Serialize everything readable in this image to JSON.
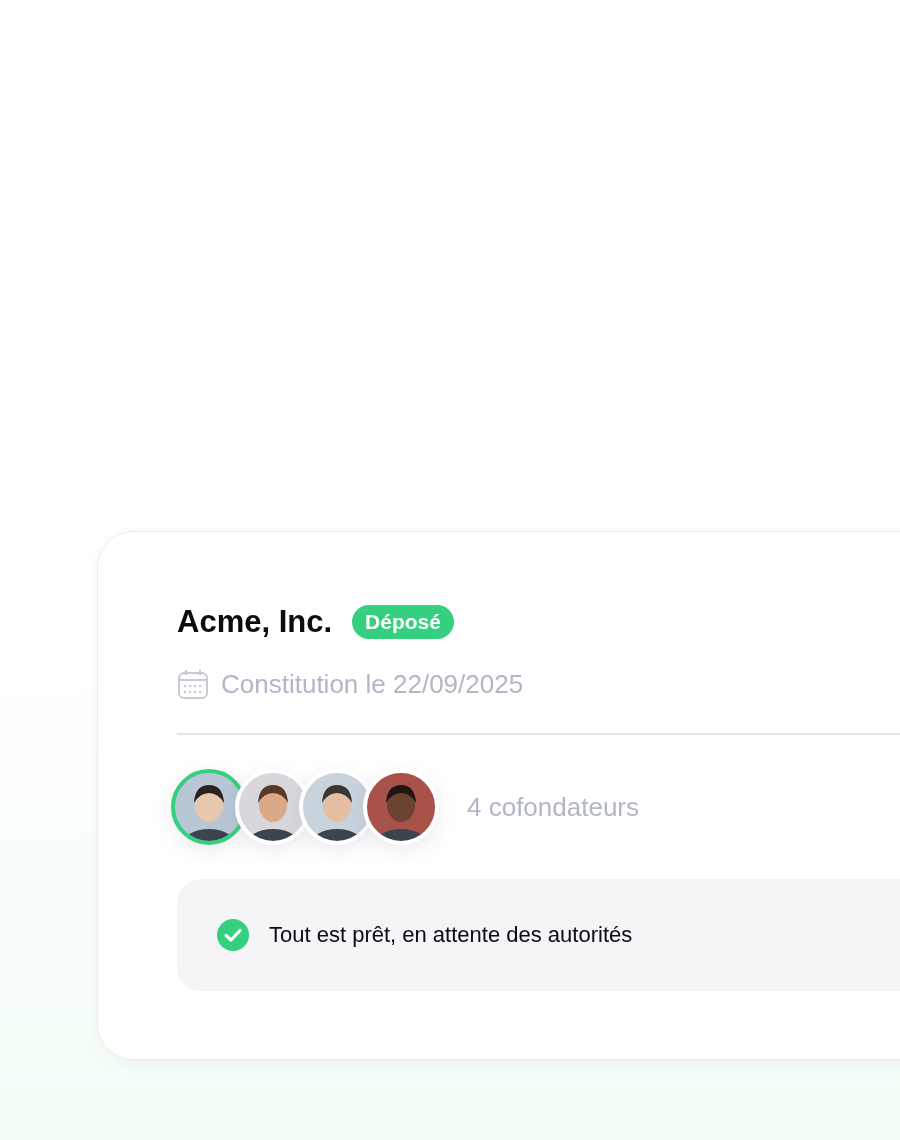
{
  "company": {
    "name": "Acme, Inc.",
    "status": "Déposé"
  },
  "incorporation": "Constitution le 22/09/2025",
  "cofounders": {
    "avatars": [
      {
        "highlighted": true
      },
      {
        "highlighted": false
      },
      {
        "highlighted": false
      },
      {
        "highlighted": false
      }
    ],
    "count_label": "4 cofondateurs"
  },
  "notice": {
    "text": "Tout est prêt, en attente des autorités"
  }
}
